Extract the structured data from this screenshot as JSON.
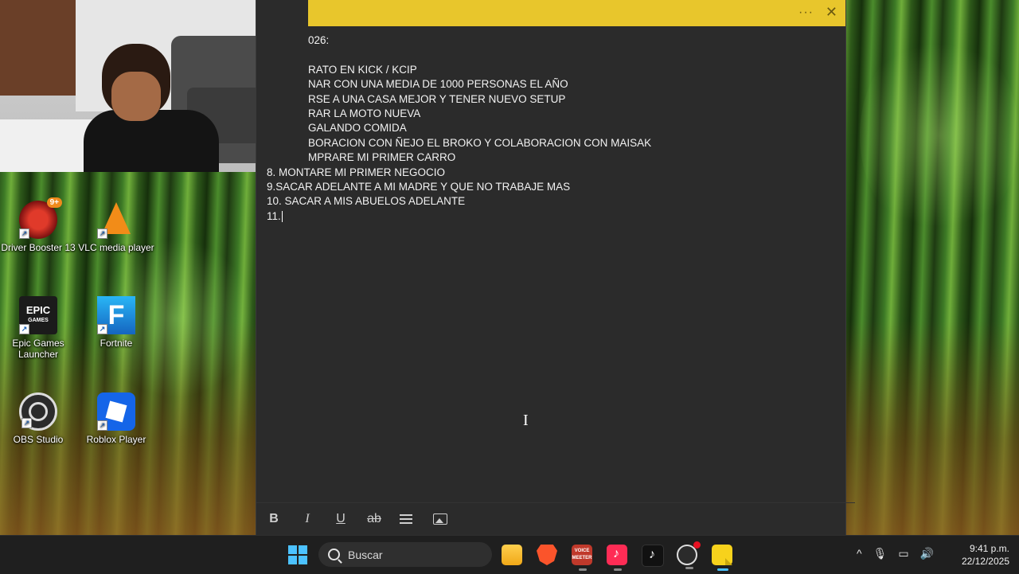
{
  "desktop": {
    "icons": [
      {
        "label": "Driver Booster 13",
        "badge": "9+",
        "icon": "driver-booster-icon"
      },
      {
        "label": "VLC media player",
        "icon": "vlc-icon"
      },
      {
        "label": "Epic Games Launcher",
        "icon_text": "EPIC",
        "icon_sub": "GAMES",
        "icon": "epic-games-icon"
      },
      {
        "label": "Fortnite",
        "icon_text": "F",
        "icon": "fortnite-icon"
      },
      {
        "label": "OBS Studio",
        "icon": "obs-icon"
      },
      {
        "label": "Roblox Player",
        "icon": "roblox-icon"
      }
    ]
  },
  "sticky_note": {
    "accent_color": "#e8c62c",
    "more_icon": "···",
    "close_icon": "✕",
    "lines": [
      "026:",
      "",
      "RATO EN KICK / KCIP",
      "NAR CON UNA MEDIA DE 1000 PERSONAS EL AÑO",
      "RSE A UNA CASA MEJOR Y TENER NUEVO SETUP",
      "RAR LA MOTO NUEVA",
      "GALANDO COMIDA",
      "BORACION CON ÑEJO EL BROKO Y COLABORACION CON MAISAK",
      "MPRARE MI PRIMER CARRO",
      "8. MONTARE MI PRIMER NEGOCIO",
      "9.SACAR ADELANTE A MI MADRE Y QUE NO TRABAJE MAS",
      "10. SACAR A MIS ABUELOS ADELANTE",
      "11."
    ],
    "toolbar": {
      "bold": "B",
      "italic": "I",
      "underline": "U",
      "strikethrough": "ab"
    }
  },
  "taskbar": {
    "search_placeholder": "Buscar",
    "voicemeeter_label": "VOICE MEETER",
    "tiktok_glyph": "♪",
    "tray": {
      "chevron": "^",
      "mic": "🎙",
      "network": "▭",
      "volume": "🔊"
    },
    "time": "9:41 p.m.",
    "date": "22/12/2025"
  }
}
